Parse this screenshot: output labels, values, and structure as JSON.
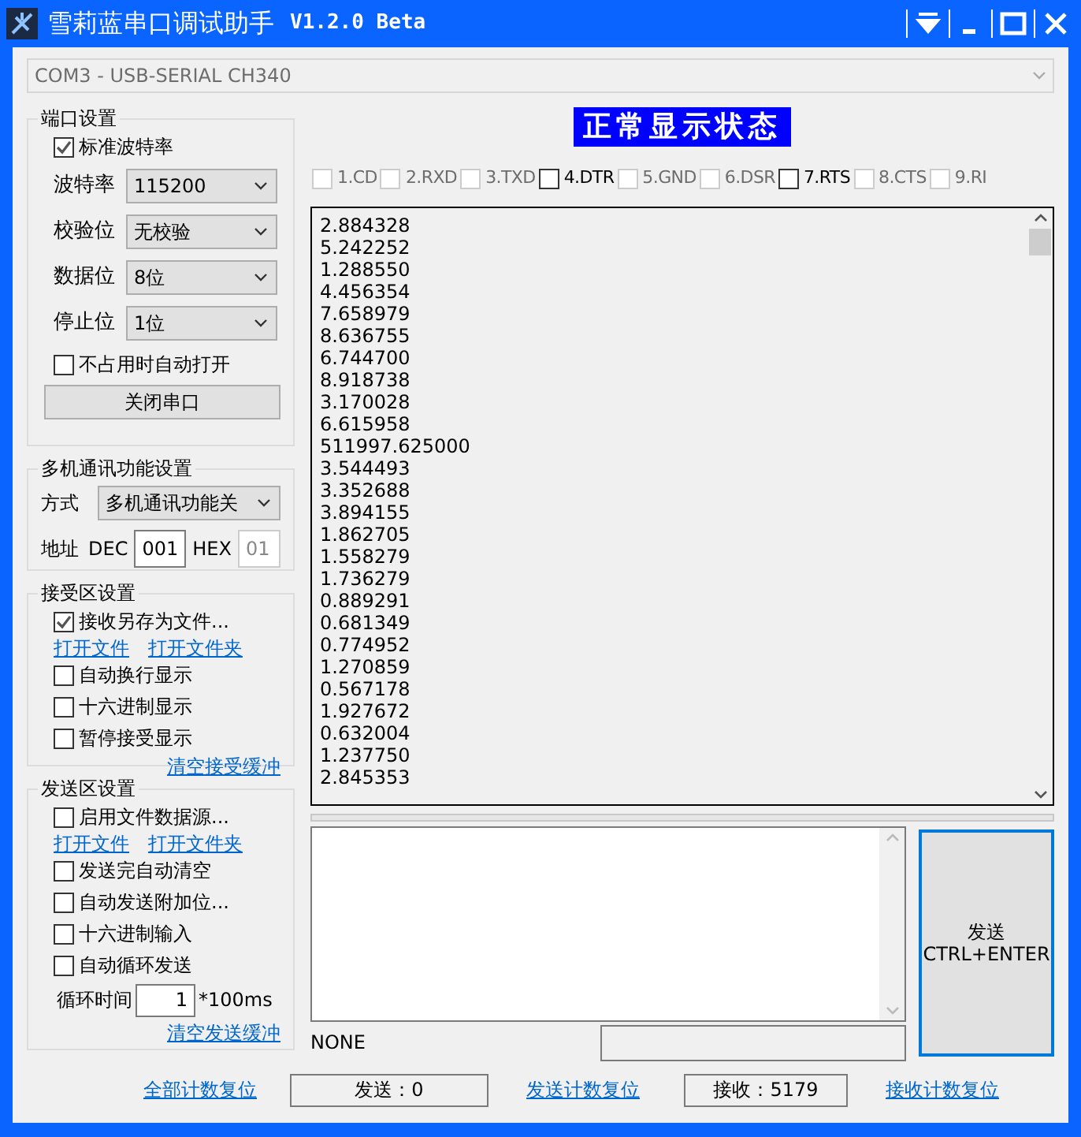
{
  "window": {
    "title": "雪莉蓝串口调试助手",
    "version": "V1.2.0 Beta"
  },
  "port_select": {
    "value": "COM3 - USB-SERIAL CH340",
    "disabled": true
  },
  "port_settings": {
    "title": "端口设置",
    "standard_baud": {
      "label": "标准波特率",
      "checked": true
    },
    "fields": [
      {
        "label": "波特率",
        "value": "115200"
      },
      {
        "label": "校验位",
        "value": "无校验"
      },
      {
        "label": "数据位",
        "value": "8位"
      },
      {
        "label": "停止位",
        "value": "1位"
      }
    ],
    "auto_open": {
      "label": "不占用时自动打开",
      "checked": false
    },
    "button": "关闭串口"
  },
  "multi_settings": {
    "title": "多机通讯功能设置",
    "mode_label": "方式",
    "mode_value": "多机通讯功能关",
    "address_label": "地址",
    "dec_label": "DEC",
    "dec_value": "001",
    "hex_label": "HEX",
    "hex_value": "01"
  },
  "receive_settings": {
    "title": "接受区设置",
    "save_to_file": {
      "label": "接收另存为文件...",
      "checked": true
    },
    "links": [
      "打开文件",
      "打开文件夹"
    ],
    "options": [
      {
        "label": "自动换行显示",
        "checked": false
      },
      {
        "label": "十六进制显示",
        "checked": false
      },
      {
        "label": "暂停接受显示",
        "checked": false
      }
    ],
    "clear_link": "清空接受缓冲"
  },
  "send_settings": {
    "title": "发送区设置",
    "file_source": {
      "label": "启用文件数据源...",
      "checked": false
    },
    "links": [
      "打开文件",
      "打开文件夹"
    ],
    "options": [
      {
        "label": "发送完自动清空",
        "checked": false
      },
      {
        "label": "自动发送附加位...",
        "checked": false
      },
      {
        "label": "十六进制输入",
        "checked": false
      },
      {
        "label": "自动循环发送",
        "checked": false
      }
    ],
    "loop_label": "循环时间",
    "loop_value": "1",
    "loop_unit": "*100ms",
    "clear_link": "清空发送缓冲"
  },
  "status_banner": "正常显示状态",
  "signals": [
    {
      "label": "1.CD",
      "checked": false,
      "disabled": true
    },
    {
      "label": "2.RXD",
      "checked": false,
      "disabled": true
    },
    {
      "label": "3.TXD",
      "checked": false,
      "disabled": true
    },
    {
      "label": "4.DTR",
      "checked": false,
      "disabled": false
    },
    {
      "label": "5.GND",
      "checked": false,
      "disabled": true
    },
    {
      "label": "6.DSR",
      "checked": false,
      "disabled": true
    },
    {
      "label": "7.RTS",
      "checked": false,
      "disabled": false
    },
    {
      "label": "8.CTS",
      "checked": false,
      "disabled": true
    },
    {
      "label": "9.RI",
      "checked": false,
      "disabled": true
    }
  ],
  "receive_lines": [
    "2.884328",
    "5.242252",
    "1.288550",
    "4.456354",
    "7.658979",
    "8.636755",
    "6.744700",
    "8.918738",
    "3.170028",
    "6.615958",
    "511997.625000",
    "3.544493",
    "3.352688",
    "3.894155",
    "1.862705",
    "1.558279",
    "1.736279",
    "0.889291",
    "0.681349",
    "0.774952",
    "1.270859",
    "0.567178",
    "1.927672",
    "0.632004",
    "1.237750",
    "2.845353"
  ],
  "send_button": [
    "发送",
    "CTRL+ENTER"
  ],
  "status_text": "NONE",
  "footer": {
    "reset_all": "全部计数复位",
    "sent": "发送：0",
    "reset_sent": "发送计数复位",
    "received": "接收：5179",
    "reset_received": "接收计数复位"
  }
}
